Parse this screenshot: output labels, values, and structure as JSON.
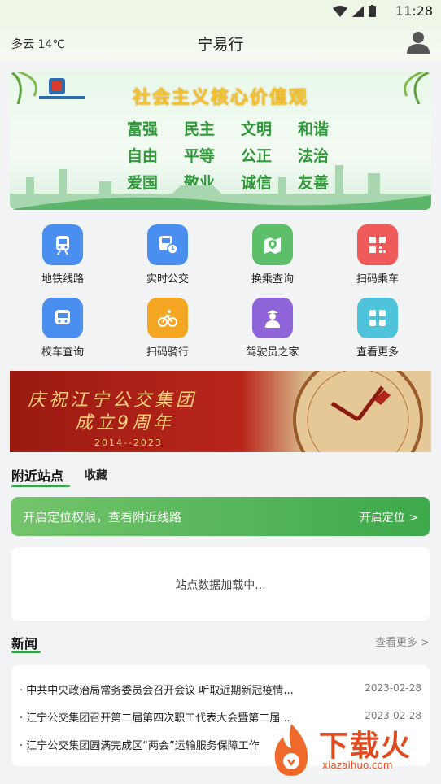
{
  "status_bar": {
    "time": "11:28"
  },
  "header": {
    "weather": "多云 14℃",
    "title": "宁易行"
  },
  "banner": {
    "headline": "社会主义核心价值观",
    "values": [
      "富强",
      "民主",
      "文明",
      "和谐",
      "自由",
      "平等",
      "公正",
      "法治",
      "爱国",
      "敬业",
      "诚信",
      "友善"
    ]
  },
  "quick_actions": [
    {
      "label": "地铁线路",
      "icon": "metro-icon",
      "color": "#4a8ff0"
    },
    {
      "label": "实时公交",
      "icon": "bus-clock-icon",
      "color": "#4a8ff0"
    },
    {
      "label": "换乘查询",
      "icon": "map-pin-icon",
      "color": "#5dbf6a"
    },
    {
      "label": "扫码乘车",
      "icon": "qrcode-icon",
      "color": "#ef5b5b"
    },
    {
      "label": "校车查询",
      "icon": "school-bus-icon",
      "color": "#4a8ff0"
    },
    {
      "label": "扫码骑行",
      "icon": "bicycle-icon",
      "color": "#f5a623"
    },
    {
      "label": "驾驶员之家",
      "icon": "driver-icon",
      "color": "#8e64d8"
    },
    {
      "label": "查看更多",
      "icon": "more-grid-icon",
      "color": "#4fc3d9"
    }
  ],
  "promo": {
    "line1": "庆祝江宁公交集团",
    "line2": "成立9周年",
    "years": "2014--2023"
  },
  "nearby": {
    "tab_active": "附近站点",
    "tab_favorites": "收藏",
    "location_prompt": "开启定位权限，查看附近线路",
    "location_button": "开启定位 >",
    "loading": "站点数据加载中..."
  },
  "news": {
    "title": "新闻",
    "more": "查看更多 >",
    "items": [
      {
        "title": "· 中共中央政治局常务委员会召开会议 听取近期新冠疫情...",
        "date": "2023-02-28"
      },
      {
        "title": "· 江宁公交集团召开第二届第四次职工代表大会暨第二届...",
        "date": "2023-02-28"
      },
      {
        "title": "· 江宁公交集团圆满完成区“两会”运输服务保障工作",
        "date": ""
      }
    ]
  },
  "watermark": {
    "text": "下载火",
    "url": "xiazaihuo.com"
  }
}
